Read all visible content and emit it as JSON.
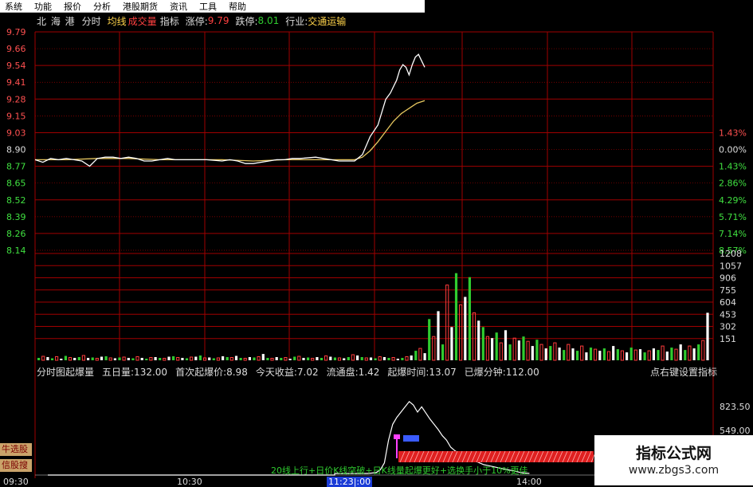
{
  "menu": [
    "系统",
    "功能",
    "报价",
    "分析",
    "港股期货",
    "资讯",
    "工具",
    "帮助"
  ],
  "info": {
    "stock_name": "北 海 港",
    "tab_time": "分时",
    "tab_avg": "均线",
    "tab_vol": "成交量",
    "tab_indicator": "指标",
    "limit_up_label": "涨停:",
    "limit_up_value": "9.79",
    "limit_down_label": "跌停:",
    "limit_down_value": "8.01",
    "industry_label": "行业:",
    "industry_value": "交通运输"
  },
  "stats": {
    "name": "分时图起爆量",
    "five_day": "五日量:132.00",
    "first_price": "首次起爆价:8.98",
    "today_profit": "今天收益:7.02",
    "float": "流通盘:1.42",
    "time": "起爆时间:13.07",
    "minutes": "已爆分钟:112.00",
    "hint": "点右键设置指标"
  },
  "side_buttons": [
    "牛选股",
    "信股搜"
  ],
  "time_labels": [
    "09:30",
    "10:30",
    "11:23|:00",
    "14:00"
  ],
  "signal_text": "20线上行+日价K线突破+日K线量起爆更好+选换手小于10%更佳",
  "watermark": {
    "title": "指标公式网",
    "url": "www.zbgs3.com"
  },
  "colors": {
    "up": "#ff3b3b",
    "down": "#2fcc2f",
    "grid": "#a00000",
    "price": "#ffffff",
    "avg": "#e8c860"
  },
  "chart_data": [
    {
      "type": "line",
      "name": "intraday-price",
      "price_ticks_left": [
        "9.79",
        "9.66",
        "9.54",
        "9.41",
        "9.28",
        "9.15",
        "9.03",
        "8.90",
        "8.77",
        "8.65",
        "8.52",
        "8.39",
        "8.26",
        "8.14"
      ],
      "pct_ticks_right": [
        "1.43%",
        "0.00%",
        "1.43%",
        "2.86%",
        "4.29%",
        "5.71%",
        "7.14%",
        "8.57%"
      ],
      "ylim": [
        8.1,
        9.8
      ],
      "series": [
        {
          "x": [
            0,
            5,
            10,
            15,
            20,
            25,
            30,
            35,
            40,
            45,
            50,
            55,
            60,
            65,
            70,
            75,
            80,
            85,
            90,
            95,
            100,
            110,
            120,
            125,
            130,
            135,
            140,
            150,
            155,
            160,
            165,
            170,
            180,
            190,
            195,
            200,
            205,
            210,
            215,
            220,
            225,
            228,
            230,
            232,
            234,
            236,
            238,
            240,
            242,
            244,
            246,
            248,
            250
          ],
          "values": [
            8.78,
            8.76,
            8.79,
            8.78,
            8.79,
            8.78,
            8.77,
            8.73,
            8.79,
            8.8,
            8.8,
            8.79,
            8.8,
            8.79,
            8.77,
            8.77,
            8.78,
            8.79,
            8.78,
            8.78,
            8.78,
            8.78,
            8.77,
            8.78,
            8.77,
            8.75,
            8.75,
            8.77,
            8.78,
            8.78,
            8.79,
            8.79,
            8.8,
            8.78,
            8.77,
            8.77,
            8.77,
            8.82,
            8.96,
            9.05,
            9.25,
            9.3,
            9.35,
            9.4,
            9.48,
            9.52,
            9.5,
            9.44,
            9.52,
            9.58,
            9.6,
            9.55,
            9.5
          ]
        },
        {
          "x": [
            0,
            20,
            40,
            60,
            80,
            100,
            120,
            140,
            160,
            180,
            200,
            205,
            210,
            215,
            220,
            225,
            230,
            235,
            240,
            245,
            250
          ],
          "values": [
            8.78,
            8.78,
            8.79,
            8.79,
            8.78,
            8.78,
            8.78,
            8.77,
            8.78,
            8.78,
            8.78,
            8.78,
            8.8,
            8.85,
            8.92,
            9.0,
            9.08,
            9.14,
            9.18,
            9.22,
            9.24
          ]
        }
      ]
    },
    {
      "type": "bar",
      "name": "intraday-volume",
      "y_ticks": [
        "1208",
        "1057",
        "906",
        "755",
        "604",
        "453",
        "302",
        "151"
      ],
      "ylim": [
        0,
        1208
      ],
      "values": [
        30,
        50,
        40,
        25,
        45,
        20,
        55,
        35,
        30,
        40,
        60,
        30,
        35,
        25,
        45,
        50,
        30,
        25,
        35,
        40,
        30,
        25,
        45,
        30,
        20,
        35,
        40,
        30,
        25,
        45,
        50,
        35,
        30,
        25,
        40,
        45,
        60,
        30,
        35,
        25,
        30,
        50,
        40,
        35,
        55,
        30,
        25,
        40,
        35,
        45,
        80,
        30,
        25,
        40,
        30,
        35,
        20,
        45,
        50,
        30,
        35,
        25,
        40,
        30,
        55,
        45,
        35,
        30,
        25,
        40,
        70,
        60,
        40,
        30,
        35,
        25,
        45,
        40,
        30,
        35,
        20,
        30,
        45,
        60,
        120,
        150,
        90,
        520,
        300,
        620,
        200,
        950,
        420,
        1100,
        700,
        800,
        1050,
        600,
        500,
        420,
        300,
        280,
        350,
        220,
        380,
        200,
        280,
        250,
        300,
        240,
        180,
        260,
        200,
        150,
        180,
        220,
        160,
        130,
        200,
        150,
        120,
        180,
        100,
        160,
        140,
        120,
        150,
        110,
        180,
        140,
        120,
        100,
        160,
        130,
        140,
        100,
        120,
        150,
        130,
        180,
        110,
        160,
        140,
        200,
        130,
        180,
        150,
        200,
        250,
        600
      ],
      "directions": "mixed"
    },
    {
      "type": "line",
      "name": "explosion-indicator",
      "y_ticks": [
        "823.50",
        "549.00"
      ],
      "ylim": [
        0,
        1000
      ],
      "values": [
        0,
        0,
        0,
        0,
        0,
        0,
        0,
        0,
        0,
        5,
        10,
        40,
        120,
        380,
        560,
        640,
        700,
        760,
        820,
        780,
        700,
        760,
        690,
        620,
        560,
        500,
        430,
        380,
        300,
        260,
        230,
        200,
        180,
        160,
        140,
        120,
        100,
        90,
        80,
        70,
        60,
        50,
        40,
        30,
        20,
        10,
        5,
        0
      ]
    }
  ]
}
